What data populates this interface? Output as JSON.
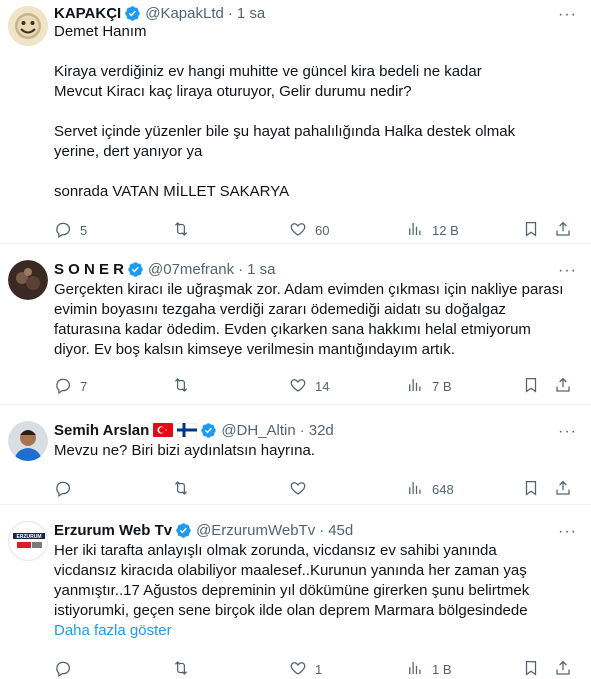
{
  "tweets": [
    {
      "name": "KAPAKÇI",
      "handle": "@KapakLtd",
      "time": "1 sa",
      "lines": [
        "Demet Hanım",
        "",
        "Kiraya verdiğiniz ev hangi muhitte ve güncel kira bedeli ne kadar",
        "Mevcut Kiracı kaç liraya oturuyor, Gelir durumu nedir?",
        "",
        "Servet içinde yüzenler bile şu hayat pahalılığında Halka destek olmak",
        "yerine, dert yanıyor ya",
        "",
        "sonrada VATAN MİLLET SAKARYA"
      ],
      "replies": "5",
      "retweets": "",
      "likes": "60",
      "views": "12 B"
    },
    {
      "name": "S O N E R",
      "handle": "@07mefrank",
      "time": "1 sa",
      "lines": [
        "Gerçekten kiracı ile uğraşmak zor. Adam evimden çıkması için nakliye parası",
        "evimin boyasını tezgaha verdiği zararı ödemediği aidatı su doğalgaz",
        "faturasına kadar ödedim. Evden çıkarken sana hakkımı helal etmiyorum",
        "diyor. Ev boş kalsın kimseye verilmesin mantığındayım artık."
      ],
      "replies": "7",
      "retweets": "",
      "likes": "14",
      "views": "7 B"
    },
    {
      "name": "Semih Arslan",
      "handle": "@DH_Altin",
      "time": "32d",
      "lines": [
        "Mevzu ne? Biri bizi aydınlatsın hayrına."
      ],
      "replies": "",
      "retweets": "",
      "likes": "",
      "views": "648"
    },
    {
      "name": "Erzurum Web Tv",
      "handle": "@ErzurumWebTv",
      "time": "45d",
      "lines": [
        "Her iki tarafta anlayışlı olmak zorunda, vicdansız ev sahibi yanında",
        "vicdansız kiracıda olabiliyor maalesef..Kurunun yanında her zaman yaş",
        "yanmıştır..17 Ağustos depreminin yıl dökümüne girerken şunu belirtmek",
        "istiyorumki, geçen sene birçok ilde olan deprem Marmara bölgesindede"
      ],
      "show_more": "Daha fazla göster",
      "avatar_text": "ERZURUM",
      "replies": "",
      "retweets": "",
      "likes": "1",
      "views": "1 B"
    }
  ],
  "colors": {
    "accent": "#1d9bf0",
    "secondary_text": "#536471",
    "border": "#eff3f4"
  },
  "icons": [
    "more-icon",
    "verified-icon",
    "reply-icon",
    "retweet-icon",
    "like-icon",
    "views-icon",
    "bookmark-icon",
    "share-icon",
    "turkey-flag-icon",
    "finland-flag-icon"
  ]
}
